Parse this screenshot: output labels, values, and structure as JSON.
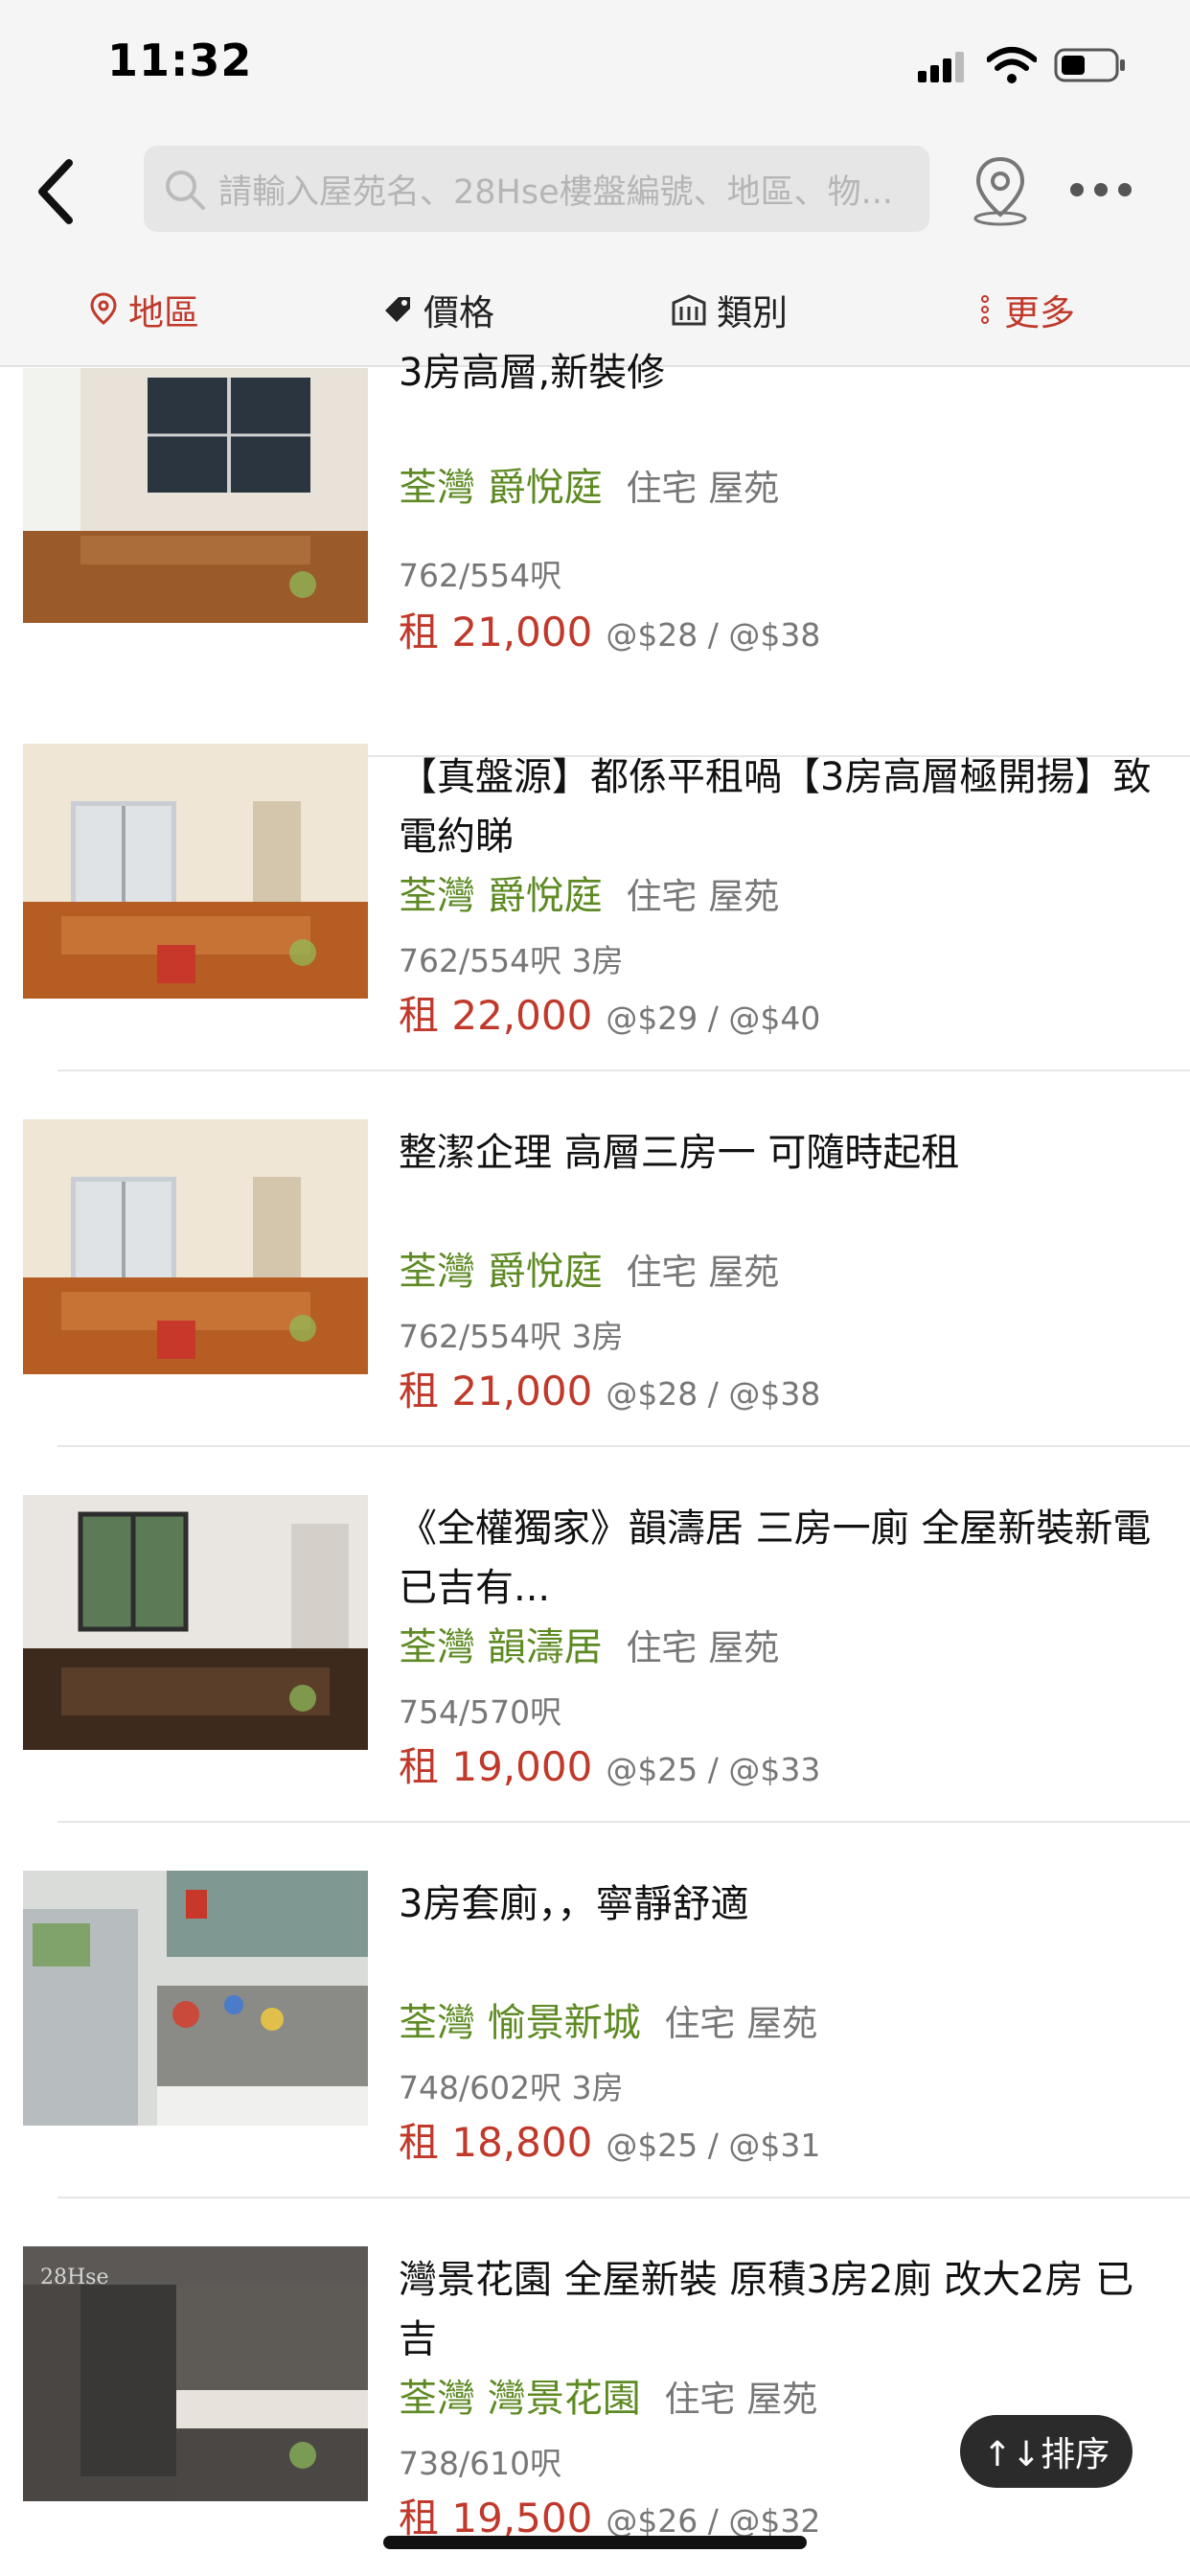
{
  "status_bar": {
    "time": "11:32"
  },
  "search": {
    "placeholder": "請輸入屋苑名、28Hse樓盤編號、地區、物..."
  },
  "filters": [
    {
      "label": "地區",
      "icon": "location-pin-icon"
    },
    {
      "label": "價格",
      "icon": "price-tag-icon"
    },
    {
      "label": "類別",
      "icon": "building-icon"
    },
    {
      "label": "更多",
      "icon": "vertical-dots-icon"
    }
  ],
  "listings": [
    {
      "title": "3房高層,新裝修",
      "district": "荃灣",
      "estate": "爵悅庭",
      "type": "住宅 屋苑",
      "area": "762/554呎",
      "price": "租 21,000",
      "unit_price": "@$28 / @$38"
    },
    {
      "title": "【真盤源】都係平租喎【3房高層極開揚】致電約睇",
      "district": "荃灣",
      "estate": "爵悅庭",
      "type": "住宅 屋苑",
      "area": "762/554呎 3房",
      "price": "租 22,000",
      "unit_price": "@$29 / @$40"
    },
    {
      "title": "整潔企理 高層三房一 可隨時起租",
      "district": "荃灣",
      "estate": "爵悅庭",
      "type": "住宅 屋苑",
      "area": "762/554呎 3房",
      "price": "租 21,000",
      "unit_price": "@$28 / @$38"
    },
    {
      "title": "《全權獨家》韻濤居 三房一廁 全屋新裝新電 已吉有...",
      "district": "荃灣",
      "estate": "韻濤居",
      "type": "住宅 屋苑",
      "area": "754/570呎",
      "price": "租 19,000",
      "unit_price": "@$25 / @$33"
    },
    {
      "title": "3房套廁，，寧靜舒適",
      "district": "荃灣",
      "estate": "愉景新城",
      "type": "住宅 屋苑",
      "area": "748/602呎 3房",
      "price": "租 18,800",
      "unit_price": "@$25 / @$31"
    },
    {
      "title": "灣景花園 全屋新裝 原積3房2廁 改大2房 已吉",
      "district": "荃灣",
      "estate": "灣景花園",
      "type": "住宅 屋苑",
      "area": "738/610呎",
      "price": "租 19,500",
      "unit_price": "@$26 / @$32",
      "watermark": "28Hse"
    }
  ],
  "sort_button": {
    "label": "↑↓排序"
  },
  "colors": {
    "accent_red": "#c0392b",
    "estate_green": "#5e8a23"
  }
}
